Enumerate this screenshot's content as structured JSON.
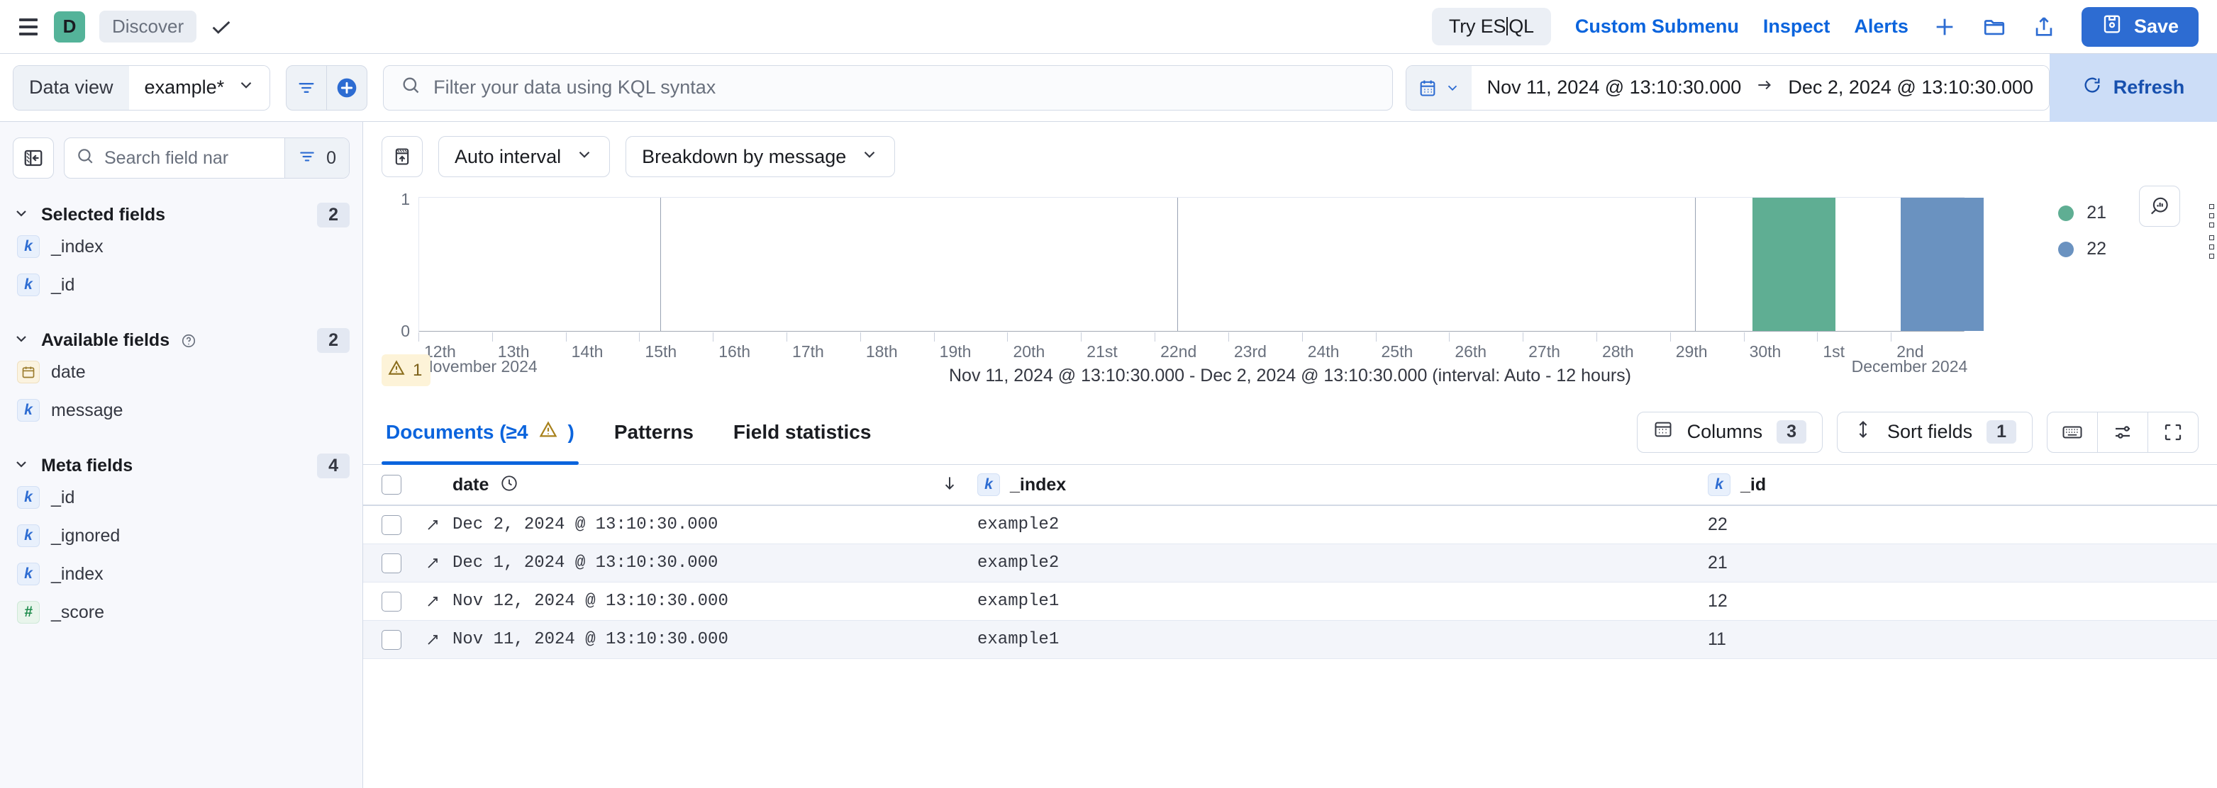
{
  "top_nav": {
    "menu_icon": "hamburger-icon",
    "app_initial": "D",
    "breadcrumb": "Discover",
    "check_icon": "check-icon",
    "esql_button": "Try ES|QL",
    "links": [
      {
        "label": "Custom Submenu"
      },
      {
        "label": "Inspect"
      },
      {
        "label": "Alerts"
      }
    ],
    "add_icon": "plus-icon",
    "open_icon": "folder-open-icon",
    "share_icon": "share-icon",
    "save_label": "Save",
    "save_icon": "save-disk-icon",
    "accent_color": "#2D6CD2",
    "app_badge_color": "#54B399"
  },
  "query_bar": {
    "data_view_label": "Data view",
    "data_view_value": "example*",
    "filter_icon": "filter-icon",
    "add_filter_icon": "add-filter-icon",
    "search_icon": "search-icon",
    "kql_placeholder": "Filter your data using KQL syntax",
    "kql_value": "",
    "calendar_icon": "calendar-icon",
    "time_start": "Nov 11, 2024 @ 13:10:30.000",
    "time_arrow": "→",
    "time_end": "Dec 2, 2024 @ 13:10:30.000",
    "refresh_label": "Refresh",
    "refresh_icon": "refresh-icon"
  },
  "sidebar": {
    "collapse_icon": "collapse-panel-icon",
    "search_placeholder": "Search field nar",
    "search_value": "",
    "filter_icon": "field-filter-icon",
    "filter_count": "0",
    "sections": [
      {
        "title": "Selected fields",
        "count": "2",
        "has_help": false,
        "fields": [
          {
            "name": "_index",
            "type": "k",
            "type_icon": "keyword-field-icon"
          },
          {
            "name": "_id",
            "type": "k",
            "type_icon": "keyword-field-icon"
          }
        ]
      },
      {
        "title": "Available fields",
        "count": "2",
        "has_help": true,
        "fields": [
          {
            "name": "date",
            "type": "date",
            "type_icon": "date-field-icon"
          },
          {
            "name": "message",
            "type": "k",
            "type_icon": "keyword-field-icon"
          }
        ]
      },
      {
        "title": "Meta fields",
        "count": "4",
        "has_help": false,
        "fields": [
          {
            "name": "_id",
            "type": "k",
            "type_icon": "keyword-field-icon"
          },
          {
            "name": "_ignored",
            "type": "k",
            "type_icon": "keyword-field-icon"
          },
          {
            "name": "_index",
            "type": "k",
            "type_icon": "keyword-field-icon"
          },
          {
            "name": "_score",
            "type": "num",
            "type_icon": "number-field-icon"
          }
        ]
      }
    ]
  },
  "chart_toolbar": {
    "hide_chart_icon": "collapse-chart-icon",
    "interval_label": "Auto interval",
    "breakdown_label": "Breakdown by message",
    "inspect_icon": "chart-inspect-icon"
  },
  "chart_data": {
    "type": "bar",
    "title": "",
    "subtitle": "Nov 11, 2024 @ 13:10:30.000 - Dec 2, 2024 @ 13:10:30.000 (interval: Auto - 12 hours)",
    "xlabel": "",
    "ylabel": "",
    "ylim": [
      0,
      1
    ],
    "ytick_labels": [
      "0",
      "1"
    ],
    "grid": false,
    "legend_position": "right",
    "x_tick_labels": [
      "12th",
      "13th",
      "14th",
      "15th",
      "16th",
      "17th",
      "18th",
      "19th",
      "20th",
      "21st",
      "22nd",
      "23rd",
      "24th",
      "25th",
      "26th",
      "27th",
      "28th",
      "29th",
      "30th",
      "1st",
      "2nd"
    ],
    "month_labels": [
      "November 2024",
      "December 2024"
    ],
    "series": [
      {
        "name": "21",
        "color": "#5FAE93",
        "categories": [
          "1st"
        ],
        "values": [
          1
        ]
      },
      {
        "name": "22",
        "color": "#6A92C0",
        "categories": [
          "2nd"
        ],
        "values": [
          1
        ]
      }
    ],
    "legend": [
      {
        "label": "21",
        "color": "#5FAE93"
      },
      {
        "label": "22",
        "color": "#6A92C0"
      }
    ],
    "warning_badge": {
      "count": "1",
      "icon": "warning-triangle-icon"
    }
  },
  "doc_tabs": {
    "tabs": [
      {
        "label": "Documents (≥4",
        "suffix": ")",
        "active": true,
        "warn_icon": "warning-triangle-icon"
      },
      {
        "label": "Patterns",
        "active": false
      },
      {
        "label": "Field statistics",
        "active": false
      }
    ],
    "columns_label": "Columns",
    "columns_count": "3",
    "columns_icon": "table-columns-icon",
    "sort_label": "Sort fields",
    "sort_count": "1",
    "sort_icon": "sort-updown-icon",
    "keyboard_icon": "keyboard-shortcuts-icon",
    "display_icon": "display-options-icon",
    "fullscreen_icon": "fullscreen-icon"
  },
  "table": {
    "select_all_icon": "select-all-checkbox",
    "headers": [
      {
        "label": "date",
        "icon": "clock-icon",
        "sorted": true,
        "sort_icon": "arrow-down-icon"
      },
      {
        "label": "_index",
        "type": "k",
        "type_icon": "keyword-field-icon"
      },
      {
        "label": "_id",
        "type": "k",
        "type_icon": "keyword-field-icon"
      }
    ],
    "rows": [
      {
        "expand_icon": "expand-row-icon",
        "date": "Dec 2, 2024 @ 13:10:30.000",
        "index": "example2",
        "id": "22"
      },
      {
        "expand_icon": "expand-row-icon",
        "date": "Dec 1, 2024 @ 13:10:30.000",
        "index": "example2",
        "id": "21"
      },
      {
        "expand_icon": "expand-row-icon",
        "date": "Nov 12, 2024 @ 13:10:30.000",
        "index": "example1",
        "id": "12"
      },
      {
        "expand_icon": "expand-row-icon",
        "date": "Nov 11, 2024 @ 13:10:30.000",
        "index": "example1",
        "id": "11"
      }
    ]
  }
}
